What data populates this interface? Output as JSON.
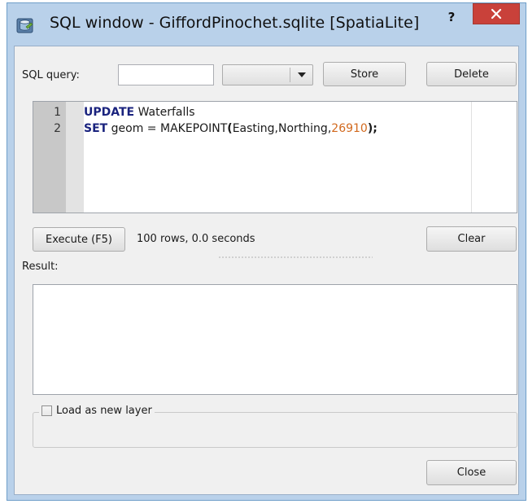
{
  "window": {
    "title": "SQL window - GiffordPinochet.sqlite [SpatiaLite]",
    "help_label": "?",
    "icon": "database-icon"
  },
  "query_bar": {
    "label": "SQL query:",
    "query_name_value": "",
    "stored_query_value": "",
    "store_label": "Store",
    "delete_label": "Delete"
  },
  "editor": {
    "lines": [
      {
        "number": "1",
        "keyword": "UPDATE",
        "text": " Waterfalls"
      },
      {
        "number": "2",
        "keyword": "SET",
        "text_before": " geom = MAKEPOINT",
        "open_paren": "(",
        "args": "Easting,Northing,",
        "srid": "26910",
        "close": ");"
      }
    ]
  },
  "execute_bar": {
    "execute_label": "Execute (F5)",
    "status": "100 rows, 0.0 seconds",
    "clear_label": "Clear"
  },
  "result": {
    "label": "Result:"
  },
  "load_layer": {
    "label": "Load as new layer",
    "checked": false
  },
  "footer": {
    "close_label": "Close"
  },
  "colors": {
    "titlebar": "#b9d1ea",
    "close_button": "#c9413a",
    "keyword": "#1a237e",
    "number": "#d2691e"
  }
}
